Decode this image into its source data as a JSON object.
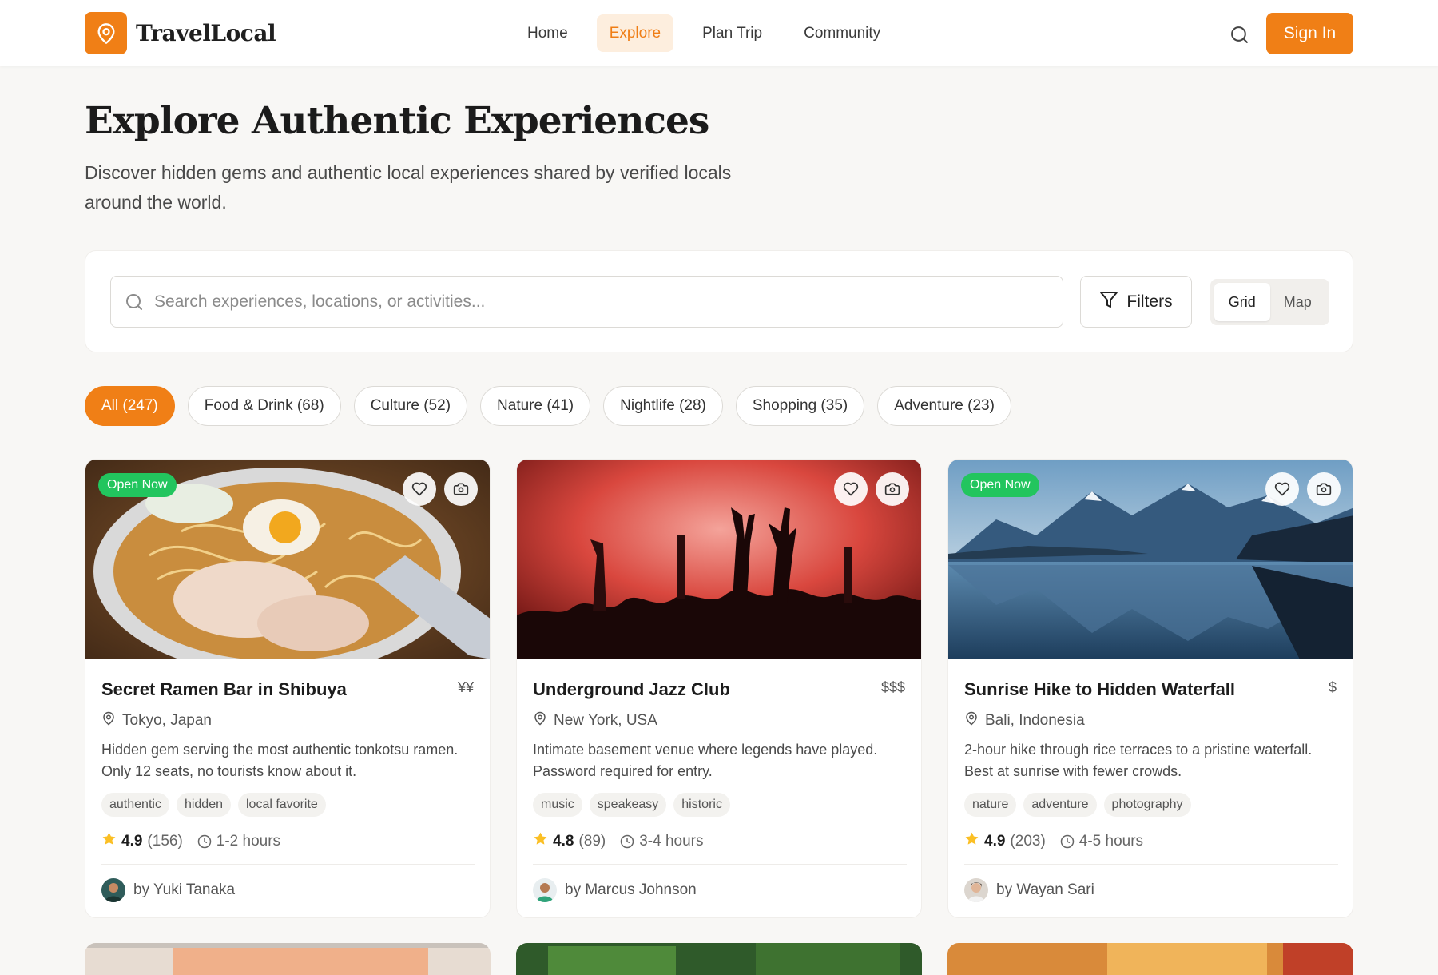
{
  "header": {
    "brand": "TravelLocal",
    "nav": [
      {
        "label": "Home",
        "active": false
      },
      {
        "label": "Explore",
        "active": true
      },
      {
        "label": "Plan Trip",
        "active": false
      },
      {
        "label": "Community",
        "active": false
      }
    ],
    "sign_in": "Sign In",
    "accent": "#f07f16"
  },
  "hero": {
    "title": "Explore Authentic Experiences",
    "subtitle": "Discover hidden gems and authentic local experiences shared by verified locals around the world."
  },
  "search": {
    "placeholder": "Search experiences, locations, or activities...",
    "value": "",
    "filters_label": "Filters",
    "view_options": [
      "Grid",
      "Map"
    ],
    "view_selected": "Grid"
  },
  "categories": [
    {
      "label": "All (247)",
      "active": true
    },
    {
      "label": "Food & Drink (68)",
      "active": false
    },
    {
      "label": "Culture (52)",
      "active": false
    },
    {
      "label": "Nature (41)",
      "active": false
    },
    {
      "label": "Nightlife (28)",
      "active": false
    },
    {
      "label": "Shopping (35)",
      "active": false
    },
    {
      "label": "Adventure (23)",
      "active": false
    }
  ],
  "cards": [
    {
      "title": "Secret Ramen Bar in Shibuya",
      "price": "¥¥",
      "location": "Tokyo, Japan",
      "description": "Hidden gem serving the most authentic tonkotsu ramen. Only 12 seats, no tourists know about it.",
      "tags": [
        "authentic",
        "hidden",
        "local favorite"
      ],
      "rating": "4.9",
      "reviews": "(156)",
      "duration": "1-2 hours",
      "author": "by Yuki Tanaka",
      "badge": "Open Now",
      "image_icon": "ramen-bowl-photo"
    },
    {
      "title": "Underground Jazz Club",
      "price": "$$$",
      "location": "New York, USA",
      "description": "Intimate basement venue where legends have played. Password required for entry.",
      "tags": [
        "music",
        "speakeasy",
        "historic"
      ],
      "rating": "4.8",
      "reviews": "(89)",
      "duration": "3-4 hours",
      "author": "by Marcus Johnson",
      "badge": "",
      "image_icon": "concert-crowd-photo"
    },
    {
      "title": "Sunrise Hike to Hidden Waterfall",
      "price": "$",
      "location": "Bali, Indonesia",
      "description": "2-hour hike through rice terraces to a pristine waterfall. Best at sunrise with fewer crowds.",
      "tags": [
        "nature",
        "adventure",
        "photography"
      ],
      "rating": "4.9",
      "reviews": "(203)",
      "duration": "4-5 hours",
      "author": "by Wayan Sari",
      "badge": "Open Now",
      "image_icon": "mountain-lake-photo"
    }
  ]
}
